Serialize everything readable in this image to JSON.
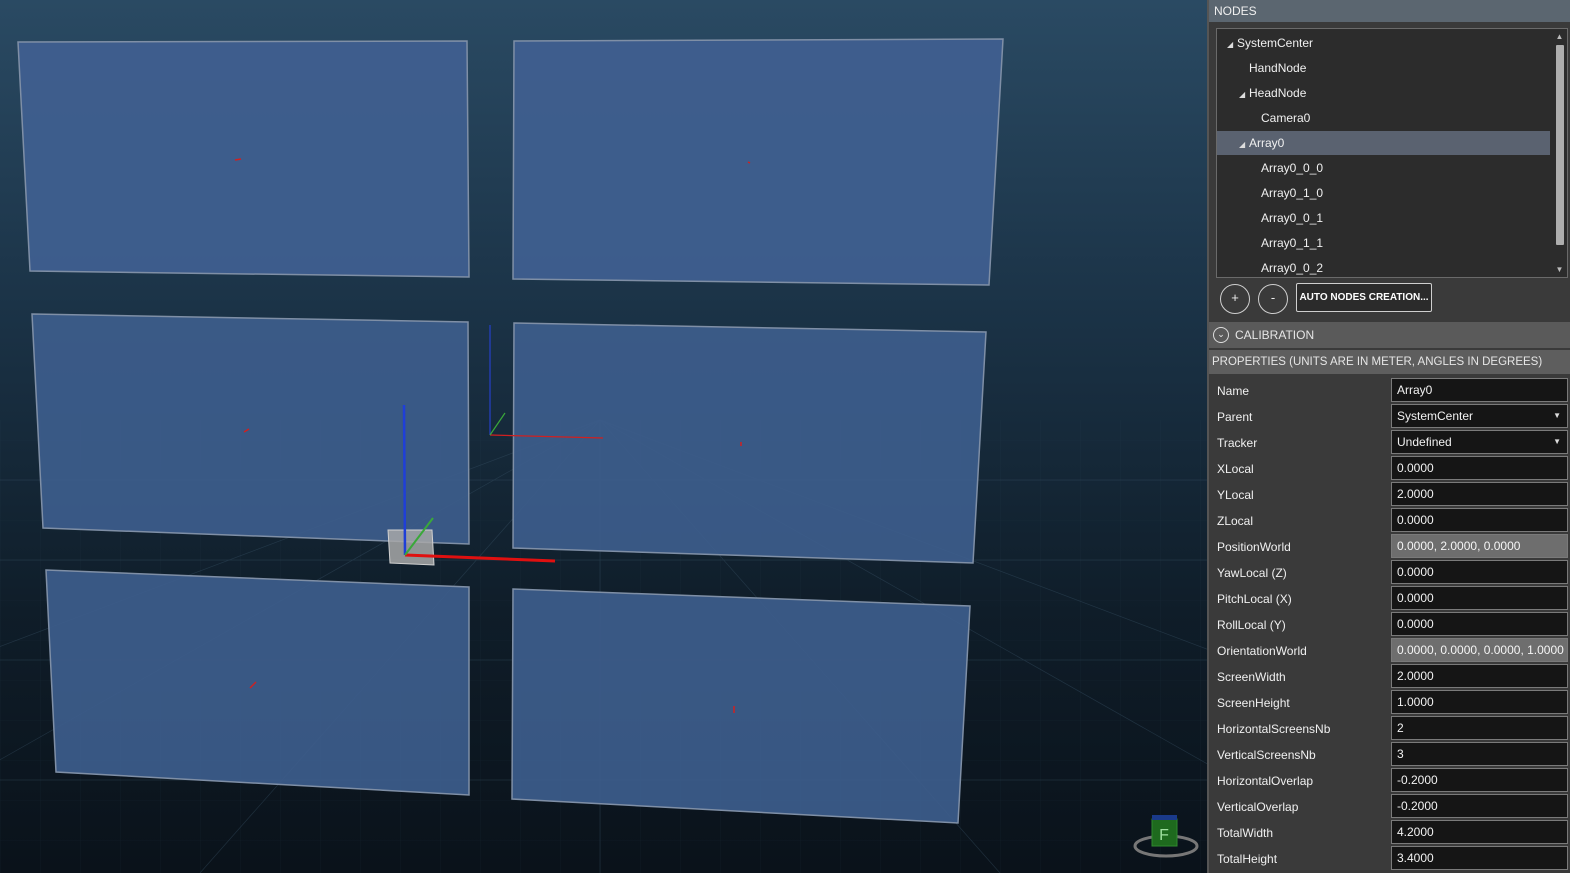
{
  "nodes": {
    "header": "NODES",
    "tree": [
      {
        "label": "SystemCenter",
        "expanded": true,
        "level": 0,
        "selected": false
      },
      {
        "label": "HandNode",
        "expanded": null,
        "level": 1,
        "selected": false
      },
      {
        "label": "HeadNode",
        "expanded": true,
        "level": 1,
        "selected": false
      },
      {
        "label": "Camera0",
        "expanded": null,
        "level": 2,
        "selected": false
      },
      {
        "label": "Array0",
        "expanded": true,
        "level": 1,
        "selected": true
      },
      {
        "label": "Array0_0_0",
        "expanded": null,
        "level": 2,
        "selected": false
      },
      {
        "label": "Array0_1_0",
        "expanded": null,
        "level": 2,
        "selected": false
      },
      {
        "label": "Array0_0_1",
        "expanded": null,
        "level": 2,
        "selected": false
      },
      {
        "label": "Array0_1_1",
        "expanded": null,
        "level": 2,
        "selected": false
      },
      {
        "label": "Array0_0_2",
        "expanded": null,
        "level": 2,
        "selected": false
      }
    ],
    "add_label": "+",
    "remove_label": "-",
    "auto_label": "AUTO NODES CREATION..."
  },
  "calibration": {
    "header": "CALIBRATION",
    "icon": "chevron-circle-icon"
  },
  "properties": {
    "header": "PROPERTIES (UNITS ARE IN METER, ANGLES IN DEGREES)",
    "rows": [
      {
        "label": "Name",
        "value": "Array0",
        "type": "text"
      },
      {
        "label": "Parent",
        "value": "SystemCenter",
        "type": "dropdown"
      },
      {
        "label": "Tracker",
        "value": "Undefined",
        "type": "dropdown"
      },
      {
        "label": "XLocal",
        "value": "0.0000",
        "type": "text"
      },
      {
        "label": "YLocal",
        "value": "2.0000",
        "type": "text"
      },
      {
        "label": "ZLocal",
        "value": "0.0000",
        "type": "text"
      },
      {
        "label": "PositionWorld",
        "value": "0.0000, 2.0000, 0.0000",
        "type": "readonly"
      },
      {
        "label": "YawLocal (Z)",
        "value": "0.0000",
        "type": "text"
      },
      {
        "label": "PitchLocal (X)",
        "value": "0.0000",
        "type": "text"
      },
      {
        "label": "RollLocal (Y)",
        "value": "0.0000",
        "type": "text"
      },
      {
        "label": "OrientationWorld",
        "value": "0.0000, 0.0000, 0.0000, 1.0000",
        "type": "readonly"
      },
      {
        "label": "ScreenWidth",
        "value": "2.0000",
        "type": "text"
      },
      {
        "label": "ScreenHeight",
        "value": "1.0000",
        "type": "text"
      },
      {
        "label": "HorizontalScreensNb",
        "value": "2",
        "type": "text"
      },
      {
        "label": "VerticalScreensNb",
        "value": "3",
        "type": "text"
      },
      {
        "label": "HorizontalOverlap",
        "value": "-0.2000",
        "type": "text"
      },
      {
        "label": "VerticalOverlap",
        "value": "-0.2000",
        "type": "text"
      },
      {
        "label": "TotalWidth",
        "value": "4.2000",
        "type": "text"
      },
      {
        "label": "TotalHeight",
        "value": "3.4000",
        "type": "text"
      }
    ]
  },
  "viewport": {
    "nav_cube_label": "F",
    "colors": {
      "screen": "#3f5f8f",
      "x_axis": "#e01010",
      "y_axis": "#1f3fd8",
      "z_axis": "#3aa83a"
    }
  }
}
